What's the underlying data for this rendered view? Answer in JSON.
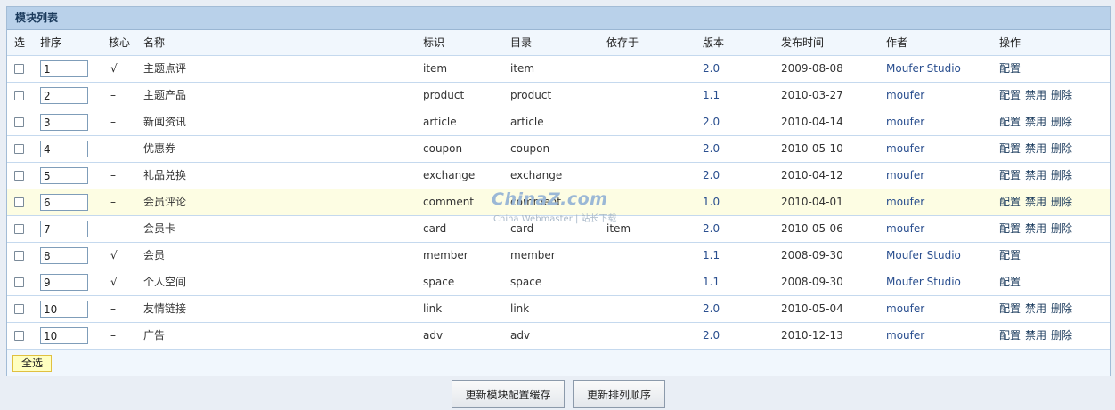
{
  "panel": {
    "title": "模块列表"
  },
  "headers": {
    "select": "选",
    "order": "排序",
    "core": "核心",
    "name": "名称",
    "identifier": "标识",
    "directory": "目录",
    "depends": "依存于",
    "version": "版本",
    "published": "发布时间",
    "author": "作者",
    "actions": "操作"
  },
  "rows": [
    {
      "order": "1",
      "core": "√",
      "name": "主题点评",
      "identifier": "item",
      "directory": "item",
      "depends": "",
      "version": "2.0",
      "date": "2009-08-08",
      "author": "Moufer Studio",
      "ops": [
        "配置"
      ]
    },
    {
      "order": "2",
      "core": "–",
      "name": "主题产品",
      "identifier": "product",
      "directory": "product",
      "depends": "",
      "version": "1.1",
      "date": "2010-03-27",
      "author": "moufer",
      "ops": [
        "配置",
        "禁用",
        "删除"
      ]
    },
    {
      "order": "3",
      "core": "–",
      "name": "新闻资讯",
      "identifier": "article",
      "directory": "article",
      "depends": "",
      "version": "2.0",
      "date": "2010-04-14",
      "author": "moufer",
      "ops": [
        "配置",
        "禁用",
        "删除"
      ]
    },
    {
      "order": "4",
      "core": "–",
      "name": "优惠券",
      "identifier": "coupon",
      "directory": "coupon",
      "depends": "",
      "version": "2.0",
      "date": "2010-05-10",
      "author": "moufer",
      "ops": [
        "配置",
        "禁用",
        "删除"
      ]
    },
    {
      "order": "5",
      "core": "–",
      "name": "礼品兑换",
      "identifier": "exchange",
      "directory": "exchange",
      "depends": "",
      "version": "2.0",
      "date": "2010-04-12",
      "author": "moufer",
      "ops": [
        "配置",
        "禁用",
        "删除"
      ]
    },
    {
      "order": "6",
      "core": "–",
      "name": "会员评论",
      "identifier": "comment",
      "directory": "comment",
      "depends": "",
      "version": "1.0",
      "date": "2010-04-01",
      "author": "moufer",
      "ops": [
        "配置",
        "禁用",
        "删除"
      ]
    },
    {
      "order": "7",
      "core": "–",
      "name": "会员卡",
      "identifier": "card",
      "directory": "card",
      "depends": "item",
      "version": "2.0",
      "date": "2010-05-06",
      "author": "moufer",
      "ops": [
        "配置",
        "禁用",
        "删除"
      ]
    },
    {
      "order": "8",
      "core": "√",
      "name": "会员",
      "identifier": "member",
      "directory": "member",
      "depends": "",
      "version": "1.1",
      "date": "2008-09-30",
      "author": "Moufer Studio",
      "ops": [
        "配置"
      ]
    },
    {
      "order": "9",
      "core": "√",
      "name": "个人空间",
      "identifier": "space",
      "directory": "space",
      "depends": "",
      "version": "1.1",
      "date": "2008-09-30",
      "author": "Moufer Studio",
      "ops": [
        "配置"
      ]
    },
    {
      "order": "10",
      "core": "–",
      "name": "友情链接",
      "identifier": "link",
      "directory": "link",
      "depends": "",
      "version": "2.0",
      "date": "2010-05-04",
      "author": "moufer",
      "ops": [
        "配置",
        "禁用",
        "删除"
      ]
    },
    {
      "order": "10",
      "core": "–",
      "name": "广告",
      "identifier": "adv",
      "directory": "adv",
      "depends": "",
      "version": "2.0",
      "date": "2010-12-13",
      "author": "moufer",
      "ops": [
        "配置",
        "禁用",
        "删除"
      ]
    }
  ],
  "highlight_row": 5,
  "select_all_label": "全选",
  "buttons": {
    "update_cache": "更新模块配置缓存",
    "update_order": "更新排列顺序"
  },
  "watermark": {
    "brand": "ChinaZ.com",
    "sub": "China Webmaster | 站长下载"
  },
  "colors": {
    "header_bar": "#b9d1ea",
    "link": "#2a4f8f",
    "highlight": "#fdfde3"
  }
}
